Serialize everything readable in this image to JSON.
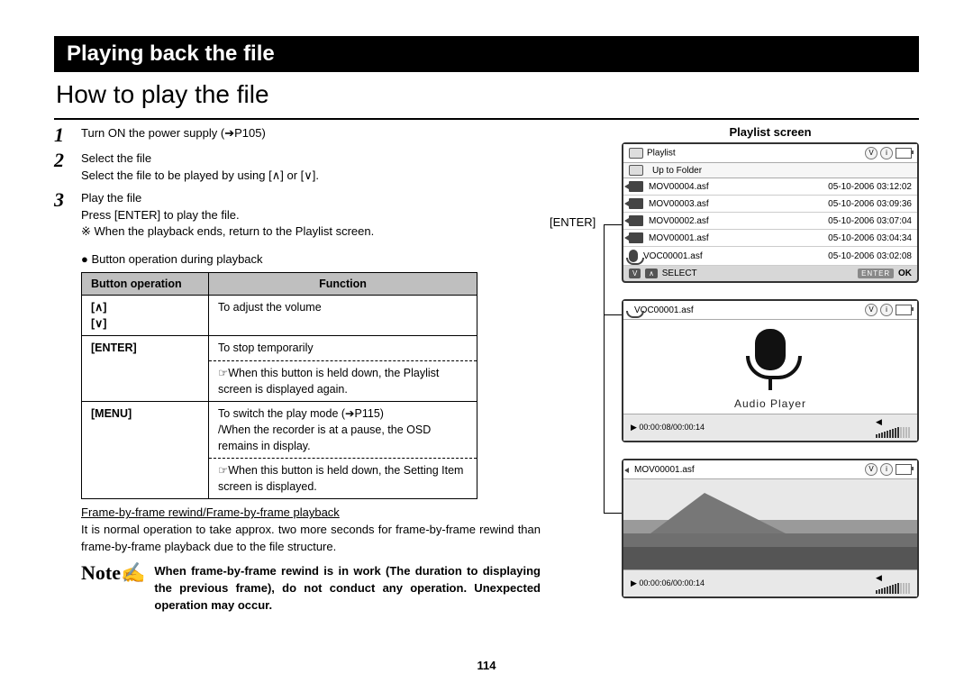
{
  "header": {
    "title": "Playing back the file"
  },
  "subhead": "How to play the file",
  "steps": [
    {
      "num": "1",
      "title": "Turn ON the power supply (➔P105)"
    },
    {
      "num": "2",
      "title": "Select the file",
      "desc": "Select the file to be played by using [∧] or [∨]."
    },
    {
      "num": "3",
      "title": "Play the file",
      "line1": "Press [ENTER] to play the file.",
      "line2": "※  When the playback ends, return to the Playlist screen."
    }
  ],
  "table": {
    "caption": "● Button operation during playback",
    "h1": "Button operation",
    "h2": "Function",
    "rows": {
      "r1": {
        "label": "[∧]\n[∨]",
        "val": "To adjust the volume"
      },
      "r2": {
        "label": "[ENTER]",
        "v1": "To stop temporarily",
        "v2": "☞When this button is held down, the Playlist screen is displayed again."
      },
      "r3": {
        "label": "[MENU]",
        "v1": "To switch the play mode (➔P115)\n/When the recorder is at a pause, the OSD remains in display.",
        "v2": "☞When this button is held down, the Setting Item screen is displayed."
      }
    }
  },
  "frame": {
    "title": "Frame-by-frame rewind/Frame-by-frame playback",
    "body": "It is normal operation to take approx. two more seconds for frame-by-frame rewind than frame-by-frame playback due to the file structure."
  },
  "note": {
    "label": "Note✍",
    "text": "When frame-by-frame rewind is in work (The duration to displaying the previous frame), do not conduct any operation. Unexpected operation may occur."
  },
  "right": {
    "playlist_title": "Playlist screen",
    "enter_label": "[ENTER]",
    "top_label": "Playlist",
    "up_label": "Up to Folder",
    "v_badge": "V",
    "i_badge": "i",
    "items": [
      {
        "name": "MOV00004.asf",
        "date": "05-10-2006 03:12:02"
      },
      {
        "name": "MOV00003.asf",
        "date": "05-10-2006 03:09:36"
      },
      {
        "name": "MOV00002.asf",
        "date": "05-10-2006 03:07:04"
      },
      {
        "name": "MOV00001.asf",
        "date": "05-10-2006 03:04:34"
      },
      {
        "name": "VOC00001.asf",
        "date": "05-10-2006 03:02:08"
      }
    ],
    "select_label": "SELECT",
    "ok_key": "ENTER",
    "ok_label": "OK",
    "audio": {
      "file": "VOC00001.asf",
      "title": "Audio Player",
      "time": "00:00:08/00:00:14"
    },
    "video": {
      "file": "MOV00001.asf",
      "time": "00:00:06/00:00:14"
    }
  },
  "page_number": "114"
}
